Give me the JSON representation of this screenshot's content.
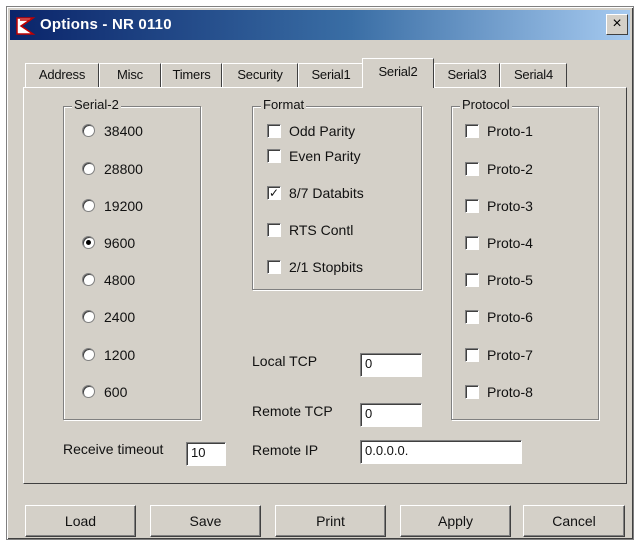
{
  "window": {
    "title": "Options - NR 0110",
    "close_glyph": "×"
  },
  "tabs": [
    {
      "label": "Address",
      "active": false
    },
    {
      "label": "Misc",
      "active": false
    },
    {
      "label": "Timers",
      "active": false
    },
    {
      "label": "Security",
      "active": false
    },
    {
      "label": "Serial1",
      "active": false
    },
    {
      "label": "Serial2",
      "active": true
    },
    {
      "label": "Serial3",
      "active": false
    },
    {
      "label": "Serial4",
      "active": false
    }
  ],
  "serial_group": {
    "label": "Serial-2",
    "options": [
      {
        "label": "38400",
        "selected": false
      },
      {
        "label": "28800",
        "selected": false
      },
      {
        "label": "19200",
        "selected": false
      },
      {
        "label": "9600",
        "selected": true
      },
      {
        "label": "4800",
        "selected": false
      },
      {
        "label": "2400",
        "selected": false
      },
      {
        "label": "1200",
        "selected": false
      },
      {
        "label": "600",
        "selected": false
      }
    ]
  },
  "format_group": {
    "label": "Format",
    "options": [
      {
        "label": "Odd Parity",
        "checked": false
      },
      {
        "label": "Even Parity",
        "checked": false
      },
      {
        "label": "8/7 Databits",
        "checked": true
      },
      {
        "label": "RTS Contl",
        "checked": false
      },
      {
        "label": "2/1 Stopbits",
        "checked": false
      }
    ]
  },
  "protocol_group": {
    "label": "Protocol",
    "options": [
      {
        "label": "Proto-1",
        "checked": false
      },
      {
        "label": "Proto-2",
        "checked": false
      },
      {
        "label": "Proto-3",
        "checked": false
      },
      {
        "label": "Proto-4",
        "checked": false
      },
      {
        "label": "Proto-5",
        "checked": false
      },
      {
        "label": "Proto-6",
        "checked": false
      },
      {
        "label": "Proto-7",
        "checked": false
      },
      {
        "label": "Proto-8",
        "checked": false
      }
    ]
  },
  "fields": {
    "local_tcp": {
      "label": "Local TCP",
      "value": "0"
    },
    "remote_tcp": {
      "label": "Remote TCP",
      "value": "0"
    },
    "remote_ip": {
      "label": "Remote IP",
      "value": "0.0.0.0."
    },
    "receive_timeout": {
      "label": "Receive timeout",
      "value": "10"
    }
  },
  "buttons": {
    "load": "Load",
    "save": "Save",
    "print": "Print",
    "apply": "Apply",
    "cancel": "Cancel"
  },
  "check_glyph": "✓",
  "colors": {
    "face": "#d4d0c8",
    "title_start": "#0a246a",
    "title_end": "#a6caf0"
  }
}
